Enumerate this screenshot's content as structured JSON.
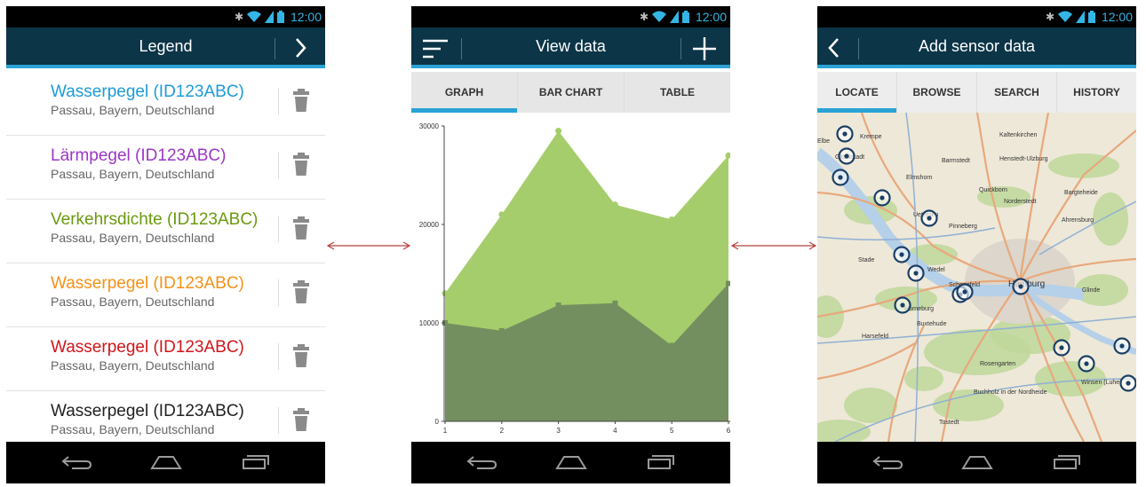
{
  "status_time": "12:00",
  "colors": {
    "accent": "#2aa3d6",
    "actionbar": "#0c3547",
    "area_top": "#a5cd6b",
    "area_bottom": "#748f5f",
    "marker": "#1b3f66"
  },
  "legend_screen": {
    "title": "Legend",
    "next_icon": "chevron-right-icon",
    "items": [
      {
        "name": "Wasserpegel (ID123ABC)",
        "location": "Passau, Bayern, Deutschland",
        "color": "#1c9bd7"
      },
      {
        "name": "Lärmpegel (ID123ABC)",
        "location": "Passau, Bayern, Deutschland",
        "color": "#9b36c6"
      },
      {
        "name": "Verkehrsdichte (ID123ABC)",
        "location": "Passau, Bayern, Deutschland",
        "color": "#6a9a0f"
      },
      {
        "name": "Wasserpegel (ID123ABC)",
        "location": "Passau, Bayern, Deutschland",
        "color": "#f49216"
      },
      {
        "name": "Wasserpegel (ID123ABC)",
        "location": "Passau, Bayern, Deutschland",
        "color": "#d0161b"
      },
      {
        "name": "Wasserpegel (ID123ABC)",
        "location": "Passau, Bayern, Deutschland",
        "color": "#222222"
      }
    ]
  },
  "view_screen": {
    "title": "View data",
    "tabs": [
      {
        "label": "GRAPH",
        "active": true
      },
      {
        "label": "BAR CHART",
        "active": false
      },
      {
        "label": "TABLE",
        "active": false
      }
    ]
  },
  "chart_data": {
    "type": "area",
    "x": [
      1,
      2,
      3,
      4,
      5,
      6
    ],
    "series": [
      {
        "values": [
          13000,
          21000,
          29500,
          22000,
          20500,
          27000
        ],
        "color": "#a5cd6b"
      },
      {
        "values": [
          10000,
          9200,
          11800,
          12000,
          7700,
          14000
        ],
        "color": "#748f5f"
      }
    ],
    "ylim": [
      0,
      30000
    ],
    "yticks": [
      0,
      10000,
      20000,
      30000
    ],
    "xticks": [
      1,
      2,
      3,
      4,
      5,
      6
    ]
  },
  "add_screen": {
    "title": "Add sensor data",
    "tabs": [
      {
        "label": "LOCATE",
        "active": true
      },
      {
        "label": "BROWSE",
        "active": false
      },
      {
        "label": "SEARCH",
        "active": false
      },
      {
        "label": "HISTORY",
        "active": false
      }
    ],
    "map_labels": [
      "Elbe",
      "Krempe",
      "Glückstadt",
      "Kaltenkirchen",
      "Henstedt-Ulzburg",
      "Barmstedt",
      "Elmshorn",
      "Quickborn",
      "Norderstedt",
      "Bargteheide",
      "Uetersen",
      "Pinneberg",
      "Ahrensburg",
      "Stade",
      "Schenefeld",
      "Wedel",
      "Hamburg",
      "Glinde",
      "Horneburg",
      "Buxtehude",
      "Harsefeld",
      "Rosengarten",
      "Winsen (Luhe)",
      "Buchholz in der Nordheide",
      "Tostedt"
    ]
  }
}
